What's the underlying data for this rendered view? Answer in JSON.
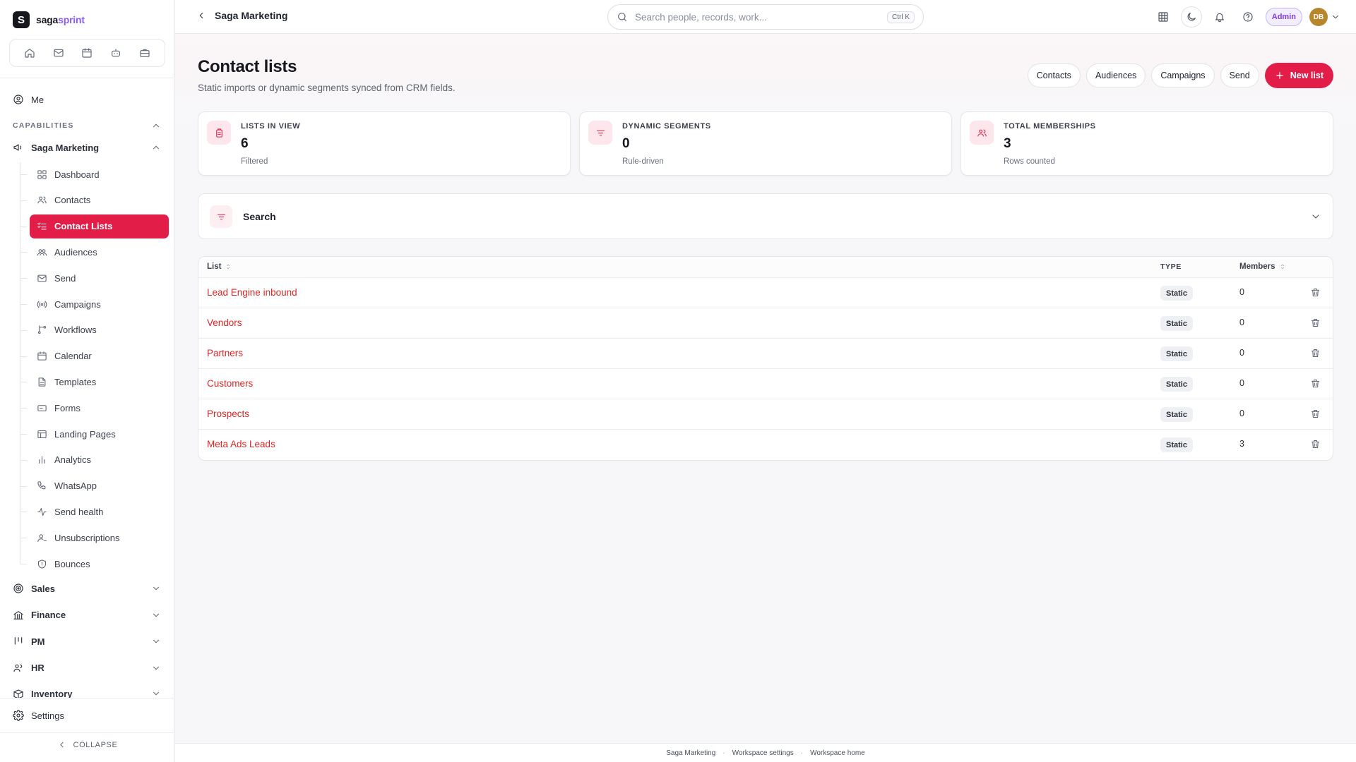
{
  "brand": {
    "initial": "S",
    "name_main": "saga",
    "name_accent": "sprint"
  },
  "sidebar": {
    "me_label": "Me",
    "capabilities_label": "CAPABILITIES",
    "group_label": "Saga Marketing",
    "items": [
      {
        "label": "Dashboard",
        "icon": "dashboard-icon"
      },
      {
        "label": "Contacts",
        "icon": "users-icon"
      },
      {
        "label": "Contact Lists",
        "icon": "list-check-icon",
        "active": true
      },
      {
        "label": "Audiences",
        "icon": "audience-icon"
      },
      {
        "label": "Send",
        "icon": "mail-icon"
      },
      {
        "label": "Campaigns",
        "icon": "broadcast-icon"
      },
      {
        "label": "Workflows",
        "icon": "workflow-icon"
      },
      {
        "label": "Calendar",
        "icon": "calendar-icon"
      },
      {
        "label": "Templates",
        "icon": "file-icon"
      },
      {
        "label": "Forms",
        "icon": "form-icon"
      },
      {
        "label": "Landing Pages",
        "icon": "layout-icon"
      },
      {
        "label": "Analytics",
        "icon": "chart-icon"
      },
      {
        "label": "WhatsApp",
        "icon": "phone-icon"
      },
      {
        "label": "Send health",
        "icon": "activity-icon"
      },
      {
        "label": "Unsubscriptions",
        "icon": "user-minus-icon"
      },
      {
        "label": "Bounces",
        "icon": "shield-icon"
      }
    ],
    "sections": [
      {
        "label": "Sales",
        "icon": "target-icon"
      },
      {
        "label": "Finance",
        "icon": "bank-icon"
      },
      {
        "label": "PM",
        "icon": "kanban-icon"
      },
      {
        "label": "HR",
        "icon": "people-icon"
      },
      {
        "label": "Inventory",
        "icon": "box-icon"
      }
    ],
    "settings_label": "Settings",
    "collapse_label": "COLLAPSE"
  },
  "header": {
    "breadcrumb": "Saga Marketing",
    "search_placeholder": "Search people, records, work...",
    "search_shortcut": "Ctrl K",
    "role_badge": "Admin",
    "avatar_initials": "DB"
  },
  "page": {
    "title": "Contact lists",
    "subtitle": "Static imports or dynamic segments synced from CRM fields.",
    "actions": [
      "Contacts",
      "Audiences",
      "Campaigns",
      "Send"
    ],
    "primary_action": "New list"
  },
  "stats": [
    {
      "label": "LISTS IN VIEW",
      "value": "6",
      "hint": "Filtered",
      "icon": "clipboard-icon"
    },
    {
      "label": "DYNAMIC SEGMENTS",
      "value": "0",
      "hint": "Rule-driven",
      "icon": "filter-icon"
    },
    {
      "label": "TOTAL MEMBERSHIPS",
      "value": "3",
      "hint": "Rows counted",
      "icon": "users-icon"
    }
  ],
  "filter": {
    "label": "Search"
  },
  "table": {
    "columns": {
      "list": "List",
      "type": "TYPE",
      "members": "Members"
    },
    "rows": [
      {
        "name": "Lead Engine inbound",
        "type": "Static",
        "members": "0"
      },
      {
        "name": "Vendors",
        "type": "Static",
        "members": "0"
      },
      {
        "name": "Partners",
        "type": "Static",
        "members": "0"
      },
      {
        "name": "Customers",
        "type": "Static",
        "members": "0"
      },
      {
        "name": "Prospects",
        "type": "Static",
        "members": "0"
      },
      {
        "name": "Meta Ads Leads",
        "type": "Static",
        "members": "3"
      }
    ]
  },
  "footer": {
    "links": [
      "Saga Marketing",
      "Workspace settings",
      "Workspace home"
    ]
  },
  "colors": {
    "accent": "#e11d48",
    "link": "#dc2626",
    "admin": "#7c3aed"
  }
}
